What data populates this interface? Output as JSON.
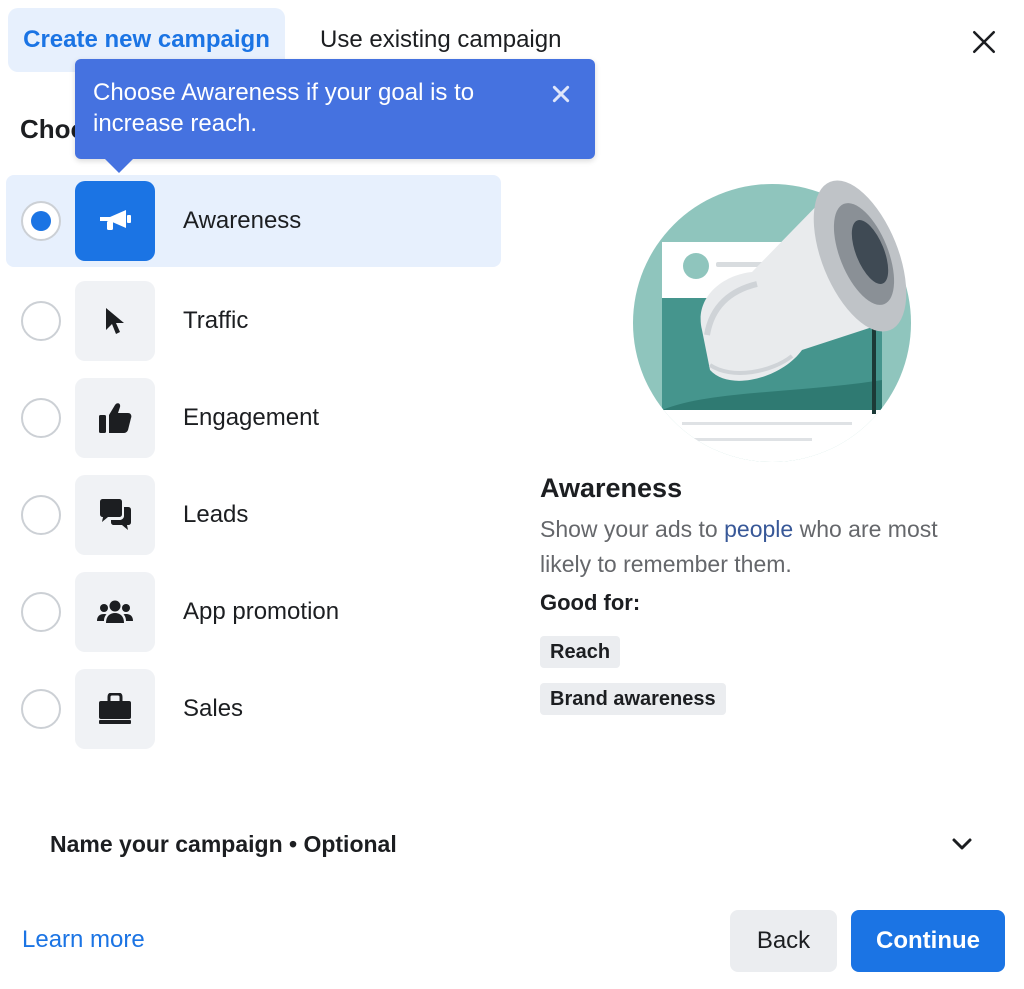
{
  "tabs": {
    "create_label": "Create new campaign",
    "existing_label": "Use existing campaign"
  },
  "heading_partial": "Choo",
  "tooltip": {
    "text": "Choose Awareness if your goal is to increase reach."
  },
  "objectives": [
    {
      "label": "Awareness",
      "icon": "megaphone-icon",
      "selected": true
    },
    {
      "label": "Traffic",
      "icon": "cursor-icon",
      "selected": false
    },
    {
      "label": "Engagement",
      "icon": "thumbs-up-icon",
      "selected": false
    },
    {
      "label": "Leads",
      "icon": "chat-bubbles-icon",
      "selected": false
    },
    {
      "label": "App promotion",
      "icon": "people-icon",
      "selected": false
    },
    {
      "label": "Sales",
      "icon": "shopping-bag-icon",
      "selected": false
    }
  ],
  "detail": {
    "title": "Awareness",
    "desc_before": "Show your ads to ",
    "desc_link": "people",
    "desc_after": " who are most likely to remember them.",
    "good_for_label": "Good for:",
    "chips": [
      "Reach",
      "Brand awareness"
    ]
  },
  "name_campaign": {
    "label": "Name your campaign • Optional"
  },
  "footer": {
    "learn_more": "Learn more",
    "back": "Back",
    "continue": "Continue"
  },
  "colors": {
    "accent": "#1b74e4",
    "tooltip_bg": "#4572e0",
    "selected_bg": "#e7f0fd",
    "illustration_teal": "#8fc5bd"
  }
}
